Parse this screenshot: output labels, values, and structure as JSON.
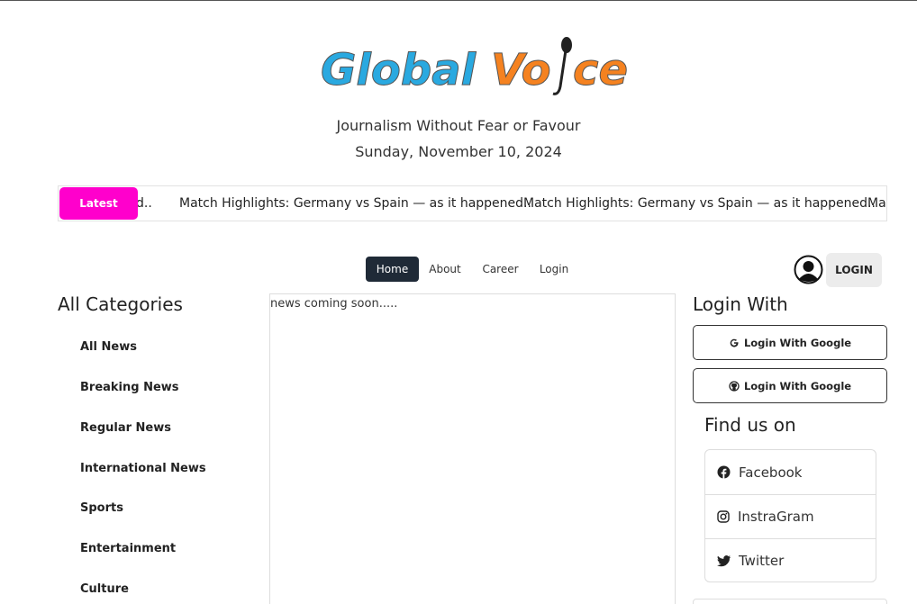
{
  "brand": {
    "logo_text_part1": "Global",
    "logo_text_part2": "Vo",
    "logo_text_part3": "ce",
    "tagline": "Journalism Without Fear or Favour",
    "date": "Sunday, November 10, 2024"
  },
  "ticker": {
    "badge": "Latest",
    "items": [
      "d..",
      "Match Highlights: Germany vs Spain — as it happened..",
      "Match Highlights: Germany vs Spain — as it happened..",
      "Ma"
    ]
  },
  "nav": {
    "items": [
      {
        "label": "Home"
      },
      {
        "label": "About"
      },
      {
        "label": "Career"
      },
      {
        "label": "Login"
      }
    ]
  },
  "user": {
    "login_button": "LOGIN"
  },
  "categories": {
    "heading": "All Categories",
    "items": [
      "All News",
      "Breaking News",
      "Regular News",
      "International News",
      "Sports",
      "Entertainment",
      "Culture"
    ]
  },
  "main": {
    "message": "news coming soon....."
  },
  "login_with": {
    "heading": "Login With",
    "buttons": [
      {
        "label": "Login With Google",
        "icon": "google-icon"
      },
      {
        "label": "Login With Google",
        "icon": "github-icon"
      }
    ]
  },
  "find_us": {
    "heading": "Find us on",
    "items": [
      {
        "label": "Facebook",
        "icon": "facebook-icon"
      },
      {
        "label": "InstraGram",
        "icon": "instagram-icon"
      },
      {
        "label": "Twitter",
        "icon": "twitter-icon"
      }
    ]
  },
  "colors": {
    "latest_badge": "#ff00cc",
    "nav_active": "#1f2a37",
    "logo_blue": "#2aa9e0",
    "logo_orange": "#f58220"
  }
}
